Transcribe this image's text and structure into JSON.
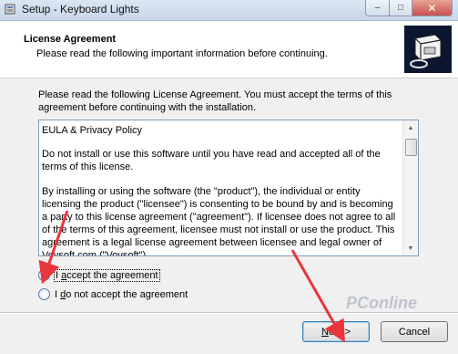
{
  "window": {
    "title": "Setup - Keyboard Lights",
    "controls": {
      "minimize": "–",
      "maximize": "□",
      "close": "✕"
    }
  },
  "header": {
    "title": "License Agreement",
    "subtitle": "Please read the following important information before continuing."
  },
  "intro": "Please read the following License Agreement. You must accept the terms of this agreement before continuing with the installation.",
  "license": {
    "paragraphs": [
      "EULA & Privacy Policy",
      "Do not install or use this software until you have read and accepted all of the terms of this license.",
      "By installing or using the software (the \"product\"), the individual or entity licensing the product (\"licensee\") is consenting to be bound by and is becoming a party to this license agreement (\"agreement\"). If licensee does not agree to all of the terms of this agreement, licensee must not install or use the product. This agreement is a legal license agreement between licensee and legal owner of Vovsoft.com (\"Vovsoft\")."
    ]
  },
  "options": {
    "accept": {
      "pre": "I ",
      "key": "a",
      "post": "ccept the agreement",
      "selected": true
    },
    "decline": {
      "pre": "I ",
      "key": "d",
      "post": "o not accept the agreement",
      "selected": false
    }
  },
  "buttons": {
    "next": {
      "key": "N",
      "rest": "ext >"
    },
    "cancel": "Cancel"
  },
  "watermark": "PConline",
  "colors": {
    "annotation_arrow": "#e8363c",
    "logo_bg": "#0d1630"
  }
}
